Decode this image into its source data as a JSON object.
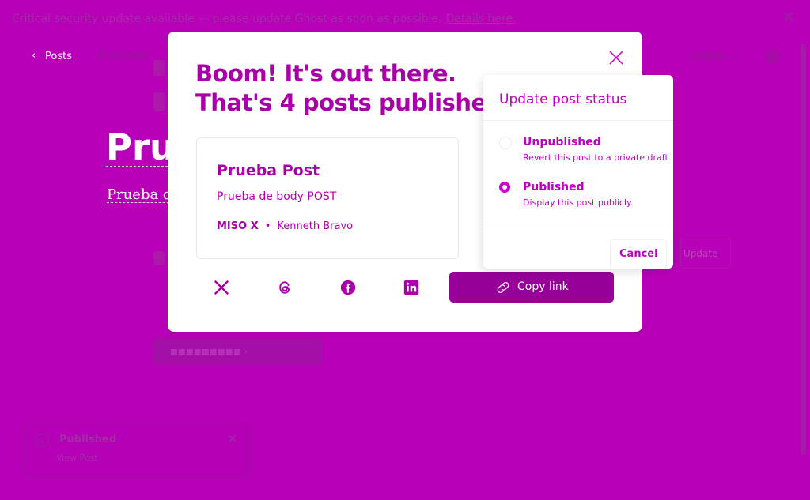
{
  "banner": {
    "message": "Critical security update available — please update Ghost as soon as possible.",
    "link": "Details here."
  },
  "editor_header": {
    "back_label": "Posts",
    "status": "Published",
    "update_label": "Update"
  },
  "editor": {
    "title": "Prueba Post",
    "body": "Prueba de body POST"
  },
  "toast": {
    "title": "Published",
    "link": "View Post"
  },
  "modal": {
    "headline_line1": "Boom! It's out there.",
    "headline_line2": "That's 4 posts published.",
    "card": {
      "title": "Prueba Post",
      "excerpt": "Prueba de body POST",
      "publication": "MISO X",
      "author": "Kenneth Bravo"
    },
    "share": {
      "icons": [
        "x-icon",
        "threads-icon",
        "facebook-icon",
        "linkedin-icon"
      ],
      "copy_link": "Copy link"
    }
  },
  "status_popover": {
    "title": "Update post status",
    "options": [
      {
        "label": "Unpublished",
        "description": "Revert this post to a private draft",
        "selected": false
      },
      {
        "label": "Published",
        "description": "Display this post publicly",
        "selected": true
      }
    ],
    "cancel": "Cancel",
    "update": "Update"
  },
  "colors": {
    "backdrop": "#b900b9",
    "accent": "#970098",
    "heading": "#a800a8"
  }
}
